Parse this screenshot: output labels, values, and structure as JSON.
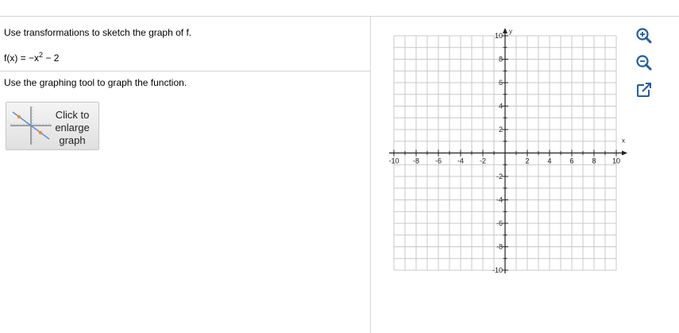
{
  "question": {
    "prompt": "Use transformations to sketch the graph of f.",
    "function_lhs": "f(x) = −x",
    "function_exponent": "2",
    "function_rhs": " − 2",
    "instruction": "Use the graphing tool to graph the function."
  },
  "enlarge_button": {
    "lines": [
      "Click to",
      "enlarge",
      "graph"
    ]
  },
  "graph": {
    "x_axis_label": "x",
    "y_axis_label": "y",
    "x_range": [
      -10,
      10
    ],
    "y_range": [
      -10,
      10
    ],
    "grid_step": 1,
    "x_tick_labels": [
      "-10",
      "-8",
      "-6",
      "-4",
      "-2",
      "2",
      "4",
      "6",
      "8",
      "10"
    ],
    "y_tick_labels": [
      "10",
      "8",
      "6",
      "4",
      "2",
      "-2",
      "-4",
      "-6",
      "-8",
      "-10"
    ],
    "grid_color": "#c8c8c8",
    "axis_color": "#222222"
  },
  "tools": {
    "zoom_in_icon": "zoom-in-icon",
    "zoom_out_icon": "zoom-out-icon",
    "popout_icon": "popout-icon",
    "icon_color": "#1f5fa0"
  }
}
